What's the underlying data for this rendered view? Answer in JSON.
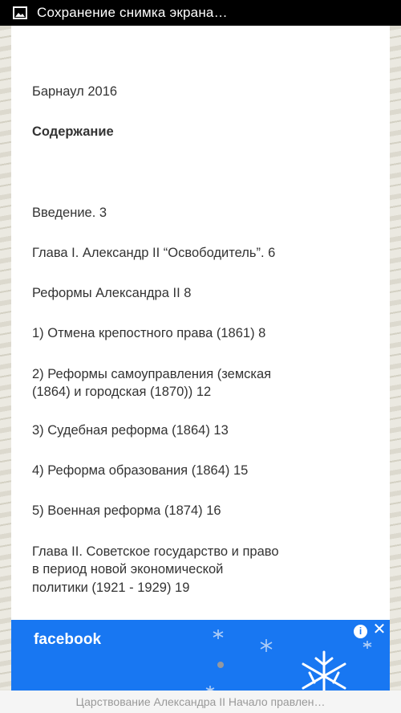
{
  "status_bar": {
    "icon": "image-icon",
    "title": "Сохранение снимка экрана…"
  },
  "document": {
    "city_year": "Барнаул 2016",
    "heading": "Содержание",
    "toc": [
      "Введение. 3",
      "Глава I. Александр II “Освободитель”. 6",
      "Реформы Александра II 8",
      "1) Отмена крепостного права (1861) 8",
      "2) Реформы самоуправления (земская",
      "(1864) и городская (1870)) 12",
      "3) Судебная реформа (1864) 13",
      "4) Реформа образования (1864) 15",
      "5) Военная реформа (1874) 16",
      "Глава II. Советское государство и право",
      "в период новой экономической",
      "политики (1921 - 1929) 19"
    ]
  },
  "ad": {
    "brand": "facebook",
    "info_label": "i",
    "close_label": "✕",
    "background_color": "#1877f2",
    "icons": [
      "info-icon",
      "close-icon",
      "snowflake-icon"
    ]
  },
  "bottom_bar": {
    "text": "Царствование Александра II Начало правлен…"
  }
}
